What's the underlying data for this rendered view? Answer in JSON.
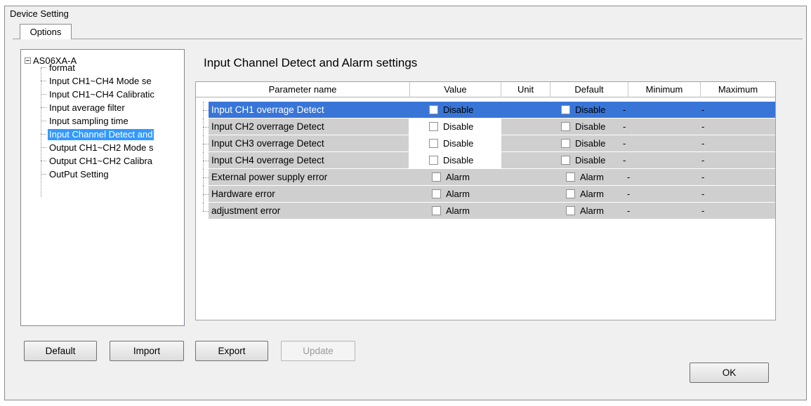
{
  "window": {
    "title": "Device Setting"
  },
  "tab": {
    "label": "Options"
  },
  "tree": {
    "root": "AS06XA-A",
    "items": [
      {
        "label": "format"
      },
      {
        "label": "Input CH1~CH4 Mode se"
      },
      {
        "label": "Input CH1~CH4 Calibratic"
      },
      {
        "label": "Input average filter"
      },
      {
        "label": "Input sampling time"
      },
      {
        "label": "Input Channel Detect and"
      },
      {
        "label": "Output CH1~CH2 Mode s"
      },
      {
        "label": "Output CH1~CH2 Calibra"
      },
      {
        "label": "OutPut Setting"
      }
    ],
    "selected_index": 5
  },
  "panel": {
    "heading": "Input Channel Detect and Alarm settings"
  },
  "grid": {
    "columns": [
      "Parameter name",
      "Value",
      "Unit",
      "Default",
      "Minimum",
      "Maximum"
    ],
    "rows": [
      {
        "name": "Input CH1 overrage Detect",
        "value": "Disable",
        "unit": "",
        "default": "Disable",
        "min": "-",
        "max": "-"
      },
      {
        "name": "Input CH2 overrage Detect",
        "value": "Disable",
        "unit": "",
        "default": "Disable",
        "min": "-",
        "max": "-"
      },
      {
        "name": "Input CH3 overrage Detect",
        "value": "Disable",
        "unit": "",
        "default": "Disable",
        "min": "-",
        "max": "-"
      },
      {
        "name": "Input CH4 overrage Detect",
        "value": "Disable",
        "unit": "",
        "default": "Disable",
        "min": "-",
        "max": "-"
      },
      {
        "name": "External power supply error",
        "value": "Alarm",
        "unit": "",
        "default": "Alarm",
        "min": "-",
        "max": "-"
      },
      {
        "name": "Hardware error",
        "value": "Alarm",
        "unit": "",
        "default": "Alarm",
        "min": "-",
        "max": "-"
      },
      {
        "name": "adjustment error",
        "value": "Alarm",
        "unit": "",
        "default": "Alarm",
        "min": "-",
        "max": "-"
      }
    ],
    "selected_row": 0
  },
  "buttons": {
    "default": "Default",
    "import": "Import",
    "export": "Export",
    "update": "Update",
    "ok": "OK"
  },
  "colors": {
    "selection": "#3875d7",
    "tree_selection": "#3399ff",
    "readonly_cell": "#cfcfcf"
  }
}
